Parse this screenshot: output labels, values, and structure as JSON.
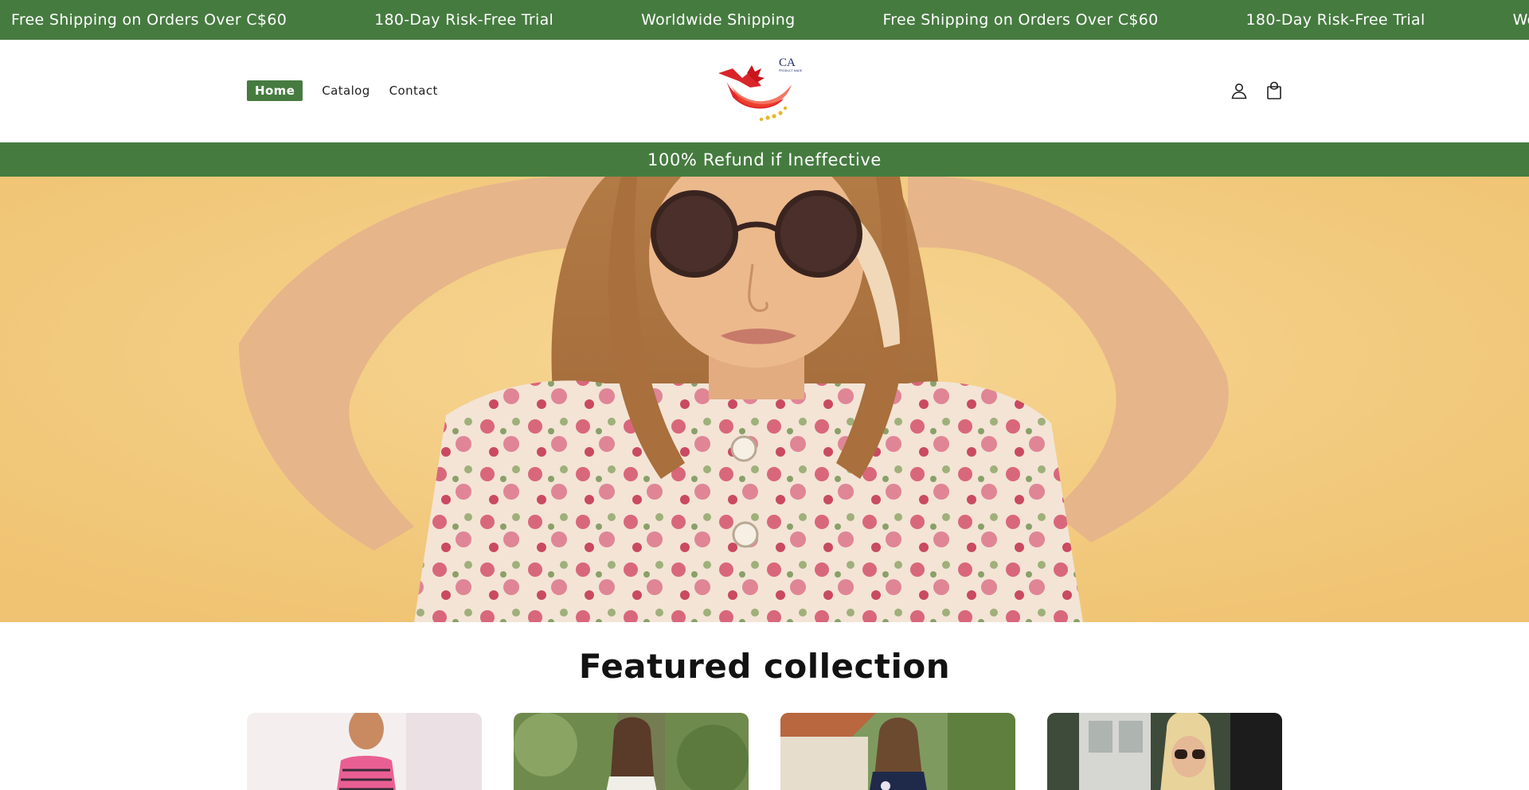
{
  "announcements": [
    "Free Shipping on Orders Over C$60",
    "180-Day Risk-Free Trial",
    "Worldwide Shipping",
    "Free Shipping on Orders Over C$60",
    "180-Day Risk-Free Trial",
    "Worldwide Shipping"
  ],
  "nav": {
    "items": [
      {
        "label": "Home",
        "active": true
      },
      {
        "label": "Catalog",
        "active": false
      },
      {
        "label": "Contact",
        "active": false
      }
    ]
  },
  "logo": {
    "text": "CA",
    "subtext": "PRODUCT MADE"
  },
  "header_icons": [
    "account-icon",
    "cart-icon"
  ],
  "refund_banner": "100% Refund if Ineffective",
  "featured": {
    "title": "Featured collection"
  },
  "colors": {
    "brand_green": "#467b40",
    "hero_bg": "#f4cc80"
  }
}
